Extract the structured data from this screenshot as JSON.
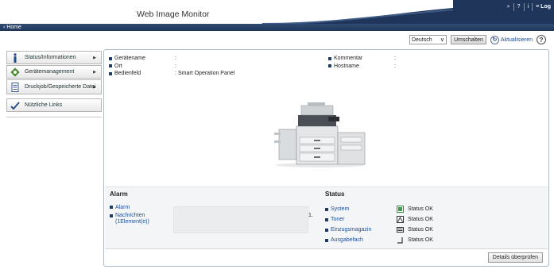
{
  "header": {
    "title": "Web Image Monitor",
    "logout_label": "Log",
    "icons": [
      "search-icon",
      "help-icon",
      "info-icon",
      "list-icon"
    ]
  },
  "nav": {
    "home_label": "Home"
  },
  "toolbar": {
    "language_value": "Deutsch",
    "switch_label": "Umschalten",
    "refresh_label": "Aktualisieren"
  },
  "sidebar": {
    "items": [
      {
        "label": "Status/Informationen",
        "icon": "info-icon"
      },
      {
        "label": "Gerätemanagement",
        "icon": "device-management-icon"
      },
      {
        "label": "Druckjob/Gespeicherte Datei",
        "icon": "document-icon"
      },
      {
        "label": "Nützliche Links",
        "icon": "links-icon"
      }
    ]
  },
  "device_info": {
    "left": [
      {
        "key": "Gerätename",
        "value": ""
      },
      {
        "key": "Ort",
        "value": ""
      },
      {
        "key": "Bedienfeld",
        "value": "Smart Operation Panel"
      }
    ],
    "right": [
      {
        "key": "Kommentar",
        "value": ""
      },
      {
        "key": "Hostname",
        "value": ""
      }
    ]
  },
  "alarm": {
    "title": "Alarm",
    "alarm_link": "Alarm",
    "messages_link_line1": "Nachrichten",
    "messages_link_line2": "(1Element(e))",
    "message_index": "1."
  },
  "status": {
    "title": "Status",
    "items": [
      {
        "name": "System",
        "value": "Status OK",
        "icon": "system-ok-icon",
        "color": "#2e8b3a"
      },
      {
        "name": "Toner",
        "value": "Status OK",
        "icon": "toner-icon",
        "color": "#333333"
      },
      {
        "name": "Einzugsmagazin",
        "value": "Status OK",
        "icon": "input-tray-icon",
        "color": "#333333"
      },
      {
        "name": "Ausgabefach",
        "value": "Status OK",
        "icon": "output-tray-icon",
        "color": "#333333"
      }
    ]
  },
  "footer": {
    "details_button": "Details überprüfen"
  },
  "colors": {
    "header_blue": "#1f365a",
    "link_blue": "#1f4f9a",
    "accent_green": "#2e8b3a"
  }
}
